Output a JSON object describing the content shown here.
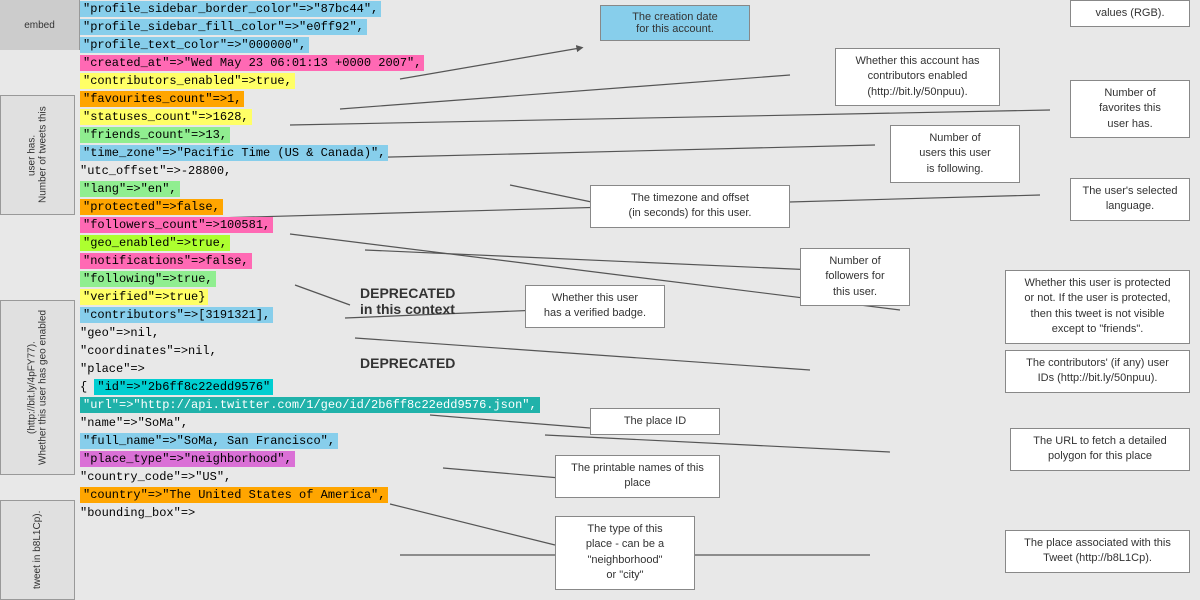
{
  "sidebar": {
    "label1": "Number of tweets this user has.",
    "label2": "Whether this user has geo enabled (http://bit.ly/4pFY77).",
    "label3": "tweet in b8L1Cp)."
  },
  "code": {
    "line1": "\"profile_sidebar_border_color\"=>\"87bc44\",",
    "line2": "\"profile_sidebar_fill_color\"=>\"e0ff92\",",
    "line3": "\"profile_text_color\"=>\"000000\",",
    "line4": "\"created_at\"=>\"Wed May 23 06:01:13 +0000 2007\",",
    "line5": "\"contributors_enabled\"=>true,",
    "line6": "\"favourites_count\"=>1,",
    "line7": "\"statuses_count\"=>1628,",
    "line8": "\"friends_count\"=>13,",
    "line9": "\"time_zone\"=>\"Pacific Time (US & Canada)\",",
    "line10": "\"utc_offset\"=>-28800,",
    "line11": "\"lang\"=>\"en\",",
    "line12": "\"protected\"=>false,",
    "line13": "\"followers_count\"=>100581,",
    "line14": "\"geo_enabled\"=>true,",
    "line15": "\"notifications\"=>false,",
    "line16": "\"following\"=>true,",
    "line17": "\"verified\"=>true}",
    "line18": "\"contributors\"=>[3191321],",
    "line19": "\"geo\"=>nil,",
    "line20": "\"coordinates\"=>nil,",
    "line21": "\"place\"=>",
    "line22": "{ \"id\"=>\"2b6ff8c22edd9576\"",
    "line23": "\"url\"=>\"http://api.twitter.com/1/geo/id/2b6ff8c22edd9576.json\",",
    "line24": "\"name\"=>\"SoMa\",",
    "line25": "\"full_name\"=>\"SoMa, San Francisco\",",
    "line26": "\"place_type\"=>\"neighborhood\",",
    "line27": "\"country_code\"=>\"US\",",
    "line28": "\"country\"=>\"The United States of America\",",
    "line29": "\"bounding_box\"=>"
  },
  "annotations": {
    "creation_date": "The creation date\nfor this account.",
    "contributors_enabled": "Whether this account has\ncontributors enabled\n(http://bit.ly/50npuu).",
    "favorites": "Number of\nfavorites this\nuser has.",
    "following": "Number of\nusers this user\nis following.",
    "timezone": "The timezone and offset\n(in seconds) for this user.",
    "language": "The user's selected\nlanguage.",
    "deprecated1": "DEPRECATED\nin this context",
    "deprecated2": "DEPRECATED",
    "verified": "Whether this user\nhas a verified badge.",
    "followers": "Number of\nfollowers for\nthis user.",
    "protected": "Whether this user is protected\nor not. If the user is protected,\nthen this tweet is not visible\nexcept to \"friends\".",
    "contributors_ids": "The contributors' (if any) user\nIDs (http://bit.ly/50npuu).",
    "place_id": "The place ID",
    "url_fetch": "The URL to fetch a detailed\npolygon for this place",
    "printable_names": "The printable names of this place",
    "place_associated": "The place associated with this\nTweet (http://b8L1Cp).",
    "place_type": "The type of this\nplace - can be a\n\"neighborhood\"\nor \"city\""
  }
}
